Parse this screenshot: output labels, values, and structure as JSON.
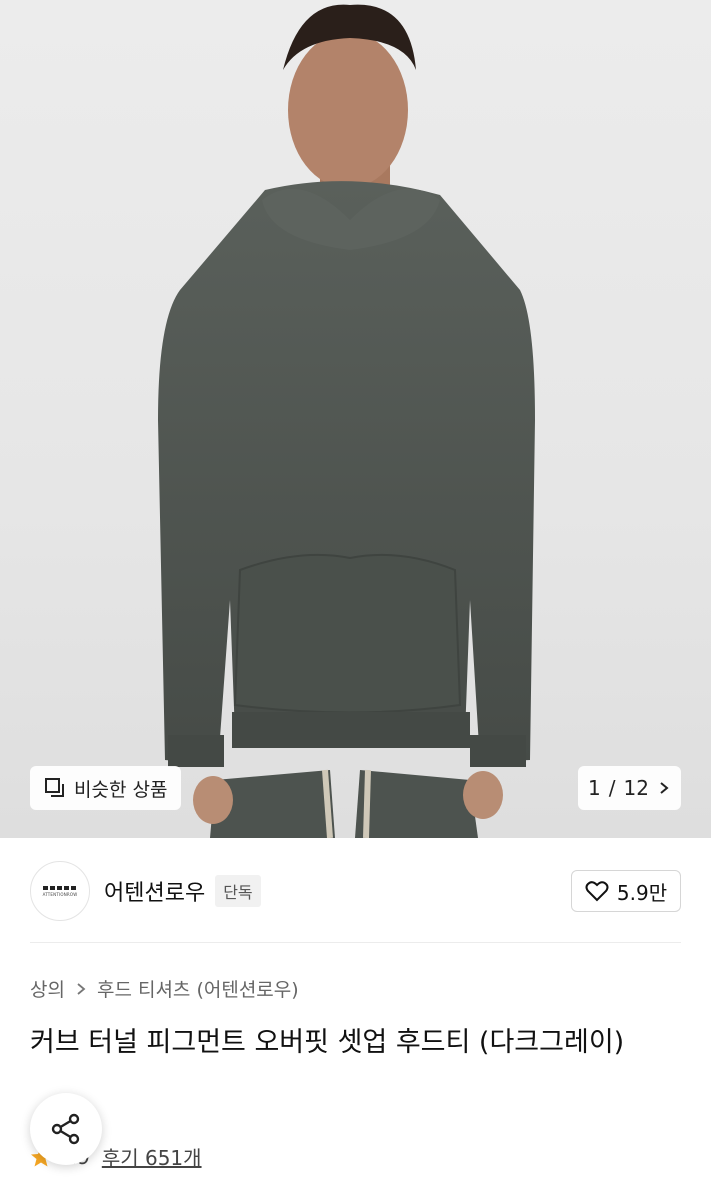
{
  "gallery": {
    "similar_label": "비슷한 상품",
    "pager_current": "1",
    "pager_separator": "/",
    "pager_total": "12"
  },
  "brand": {
    "name": "어텐션로우",
    "tag": "단독",
    "logo_text": "ATTENTIONROW",
    "likes": "5.9만"
  },
  "breadcrumb": {
    "category": "상의",
    "subcategory": "후드 티셔츠 (어텐션로우)"
  },
  "product": {
    "title": "커브 터널 피그먼트 오버핏 셋업 후드티 (다크그레이)"
  },
  "review": {
    "rating": "4.9",
    "reviews_label": "후기 651개"
  },
  "colors": {
    "hoodie": "#4f5550",
    "accent_star": "#f5a623",
    "background": "#e8e8e8"
  },
  "icons": {
    "similar": "similar-items-icon",
    "pager_next": "chevron-right-icon",
    "like": "heart-icon",
    "breadcrumb_sep": "chevron-right-icon",
    "star": "star-icon",
    "share": "share-icon"
  }
}
